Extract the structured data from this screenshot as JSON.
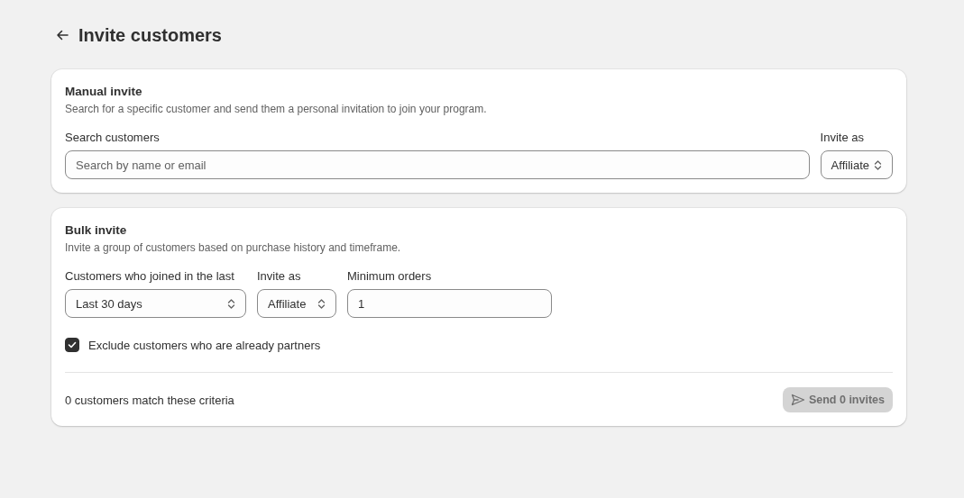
{
  "page": {
    "title": "Invite customers"
  },
  "manual_invite": {
    "title": "Manual invite",
    "description": "Search for a specific customer and send them a personal invitation to join your program.",
    "search": {
      "label": "Search customers",
      "placeholder": "Search by name or email"
    },
    "invite_as": {
      "label": "Invite as",
      "value": "Affiliate"
    }
  },
  "bulk_invite": {
    "title": "Bulk invite",
    "description": "Invite a group of customers based on purchase history and timeframe.",
    "fields": [
      {
        "kind": "select",
        "label": "Customers who joined in the last",
        "value": "Last 30 days"
      },
      {
        "kind": "select",
        "label": "Invite as",
        "value": "Affiliate"
      },
      {
        "kind": "input",
        "label": "Minimum orders",
        "value": "1"
      }
    ],
    "exclude": {
      "label": "Exclude customers who are already partners",
      "checked": true
    },
    "match_text": "0 customers match these criteria",
    "send_button": {
      "label": "Send 0 invites",
      "disabled": true
    }
  }
}
